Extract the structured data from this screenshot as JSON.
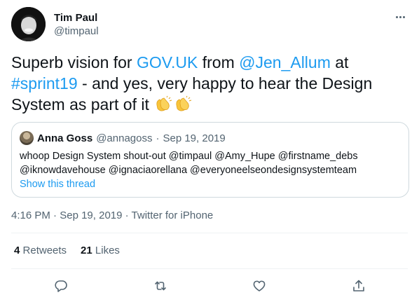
{
  "author": {
    "display_name": "Tim Paul",
    "handle": "@timpaul"
  },
  "tweet": {
    "text_1": "Superb vision for ",
    "link_govuk": "GOV.UK",
    "text_2": " from ",
    "mention_jen": "@Jen_Allum",
    "text_3": " at ",
    "hashtag": "#sprint19",
    "text_4": " - and yes, very happy to hear the Design System as part of it ",
    "emoji_name": "clapping-hands"
  },
  "quoted_tweet": {
    "display_name": "Anna Goss",
    "handle": "@annagoss",
    "separator": "·",
    "date": "Sep 19, 2019",
    "body_line_1": "whoop Design System shout-out @timpaul @Amy_Hupe @firstname_debs",
    "body_line_2": "@iknowdavehouse @ignaciaorellana @everyoneelseondesignsystemteam",
    "show_thread": "Show this thread"
  },
  "meta": {
    "time": "4:16 PM",
    "sep1": "·",
    "date": "Sep 19, 2019",
    "sep2": "·",
    "source": "Twitter for iPhone"
  },
  "stats": {
    "retweets_count": "4",
    "retweets_label": "Retweets",
    "likes_count": "21",
    "likes_label": "Likes"
  },
  "actions": {
    "icons": [
      "reply-icon",
      "retweet-icon",
      "like-icon",
      "share-icon"
    ]
  },
  "colors": {
    "link": "#1d9bf0",
    "secondary_text": "#536471",
    "primary_text": "#0f1419",
    "border": "#cfd9de"
  }
}
